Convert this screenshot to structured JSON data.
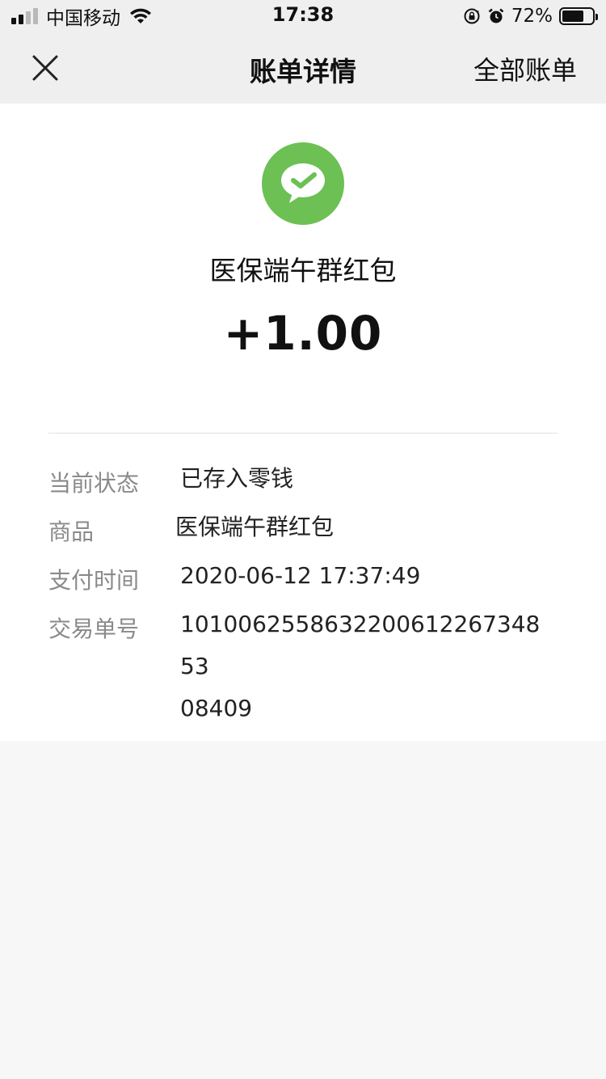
{
  "status_bar": {
    "carrier": "中国移动",
    "time": "17:38",
    "battery_percent": "72%",
    "battery_level": 0.72
  },
  "nav": {
    "title": "账单详情",
    "right_link": "全部账单",
    "close_icon": "close-icon"
  },
  "bill": {
    "merchant": "医保端午群红包",
    "amount": "+1.00",
    "brand_color": "#6cc054",
    "details": {
      "status_label": "当前状态",
      "status_value": "已存入零钱",
      "goods_label": "商品",
      "goods_value": "医保端午群红包",
      "time_label": "支付时间",
      "time_value": "2020-06-12 17:37:49",
      "txn_label": "交易单号",
      "txn_value_line1": "1010062558632200612267348 53",
      "txn_value_line2": "08409"
    }
  }
}
